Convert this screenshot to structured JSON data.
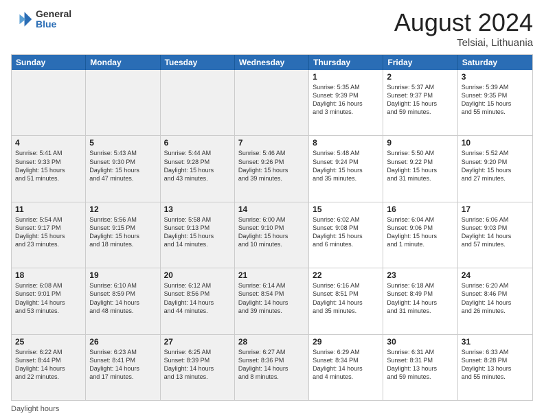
{
  "header": {
    "logo_line1": "General",
    "logo_line2": "Blue",
    "month_title": "August 2024",
    "location": "Telsiai, Lithuania"
  },
  "weekdays": [
    "Sunday",
    "Monday",
    "Tuesday",
    "Wednesday",
    "Thursday",
    "Friday",
    "Saturday"
  ],
  "footer": {
    "daylight_label": "Daylight hours"
  },
  "weeks": [
    [
      {
        "day": "",
        "info": "",
        "shaded": true
      },
      {
        "day": "",
        "info": "",
        "shaded": true
      },
      {
        "day": "",
        "info": "",
        "shaded": true
      },
      {
        "day": "",
        "info": "",
        "shaded": true
      },
      {
        "day": "1",
        "info": "Sunrise: 5:35 AM\nSunset: 9:39 PM\nDaylight: 16 hours\nand 3 minutes.",
        "shaded": false
      },
      {
        "day": "2",
        "info": "Sunrise: 5:37 AM\nSunset: 9:37 PM\nDaylight: 15 hours\nand 59 minutes.",
        "shaded": false
      },
      {
        "day": "3",
        "info": "Sunrise: 5:39 AM\nSunset: 9:35 PM\nDaylight: 15 hours\nand 55 minutes.",
        "shaded": false
      }
    ],
    [
      {
        "day": "4",
        "info": "Sunrise: 5:41 AM\nSunset: 9:33 PM\nDaylight: 15 hours\nand 51 minutes.",
        "shaded": true
      },
      {
        "day": "5",
        "info": "Sunrise: 5:43 AM\nSunset: 9:30 PM\nDaylight: 15 hours\nand 47 minutes.",
        "shaded": true
      },
      {
        "day": "6",
        "info": "Sunrise: 5:44 AM\nSunset: 9:28 PM\nDaylight: 15 hours\nand 43 minutes.",
        "shaded": true
      },
      {
        "day": "7",
        "info": "Sunrise: 5:46 AM\nSunset: 9:26 PM\nDaylight: 15 hours\nand 39 minutes.",
        "shaded": true
      },
      {
        "day": "8",
        "info": "Sunrise: 5:48 AM\nSunset: 9:24 PM\nDaylight: 15 hours\nand 35 minutes.",
        "shaded": false
      },
      {
        "day": "9",
        "info": "Sunrise: 5:50 AM\nSunset: 9:22 PM\nDaylight: 15 hours\nand 31 minutes.",
        "shaded": false
      },
      {
        "day": "10",
        "info": "Sunrise: 5:52 AM\nSunset: 9:20 PM\nDaylight: 15 hours\nand 27 minutes.",
        "shaded": false
      }
    ],
    [
      {
        "day": "11",
        "info": "Sunrise: 5:54 AM\nSunset: 9:17 PM\nDaylight: 15 hours\nand 23 minutes.",
        "shaded": true
      },
      {
        "day": "12",
        "info": "Sunrise: 5:56 AM\nSunset: 9:15 PM\nDaylight: 15 hours\nand 18 minutes.",
        "shaded": true
      },
      {
        "day": "13",
        "info": "Sunrise: 5:58 AM\nSunset: 9:13 PM\nDaylight: 15 hours\nand 14 minutes.",
        "shaded": true
      },
      {
        "day": "14",
        "info": "Sunrise: 6:00 AM\nSunset: 9:10 PM\nDaylight: 15 hours\nand 10 minutes.",
        "shaded": true
      },
      {
        "day": "15",
        "info": "Sunrise: 6:02 AM\nSunset: 9:08 PM\nDaylight: 15 hours\nand 6 minutes.",
        "shaded": false
      },
      {
        "day": "16",
        "info": "Sunrise: 6:04 AM\nSunset: 9:06 PM\nDaylight: 15 hours\nand 1 minute.",
        "shaded": false
      },
      {
        "day": "17",
        "info": "Sunrise: 6:06 AM\nSunset: 9:03 PM\nDaylight: 14 hours\nand 57 minutes.",
        "shaded": false
      }
    ],
    [
      {
        "day": "18",
        "info": "Sunrise: 6:08 AM\nSunset: 9:01 PM\nDaylight: 14 hours\nand 53 minutes.",
        "shaded": true
      },
      {
        "day": "19",
        "info": "Sunrise: 6:10 AM\nSunset: 8:59 PM\nDaylight: 14 hours\nand 48 minutes.",
        "shaded": true
      },
      {
        "day": "20",
        "info": "Sunrise: 6:12 AM\nSunset: 8:56 PM\nDaylight: 14 hours\nand 44 minutes.",
        "shaded": true
      },
      {
        "day": "21",
        "info": "Sunrise: 6:14 AM\nSunset: 8:54 PM\nDaylight: 14 hours\nand 39 minutes.",
        "shaded": true
      },
      {
        "day": "22",
        "info": "Sunrise: 6:16 AM\nSunset: 8:51 PM\nDaylight: 14 hours\nand 35 minutes.",
        "shaded": false
      },
      {
        "day": "23",
        "info": "Sunrise: 6:18 AM\nSunset: 8:49 PM\nDaylight: 14 hours\nand 31 minutes.",
        "shaded": false
      },
      {
        "day": "24",
        "info": "Sunrise: 6:20 AM\nSunset: 8:46 PM\nDaylight: 14 hours\nand 26 minutes.",
        "shaded": false
      }
    ],
    [
      {
        "day": "25",
        "info": "Sunrise: 6:22 AM\nSunset: 8:44 PM\nDaylight: 14 hours\nand 22 minutes.",
        "shaded": true
      },
      {
        "day": "26",
        "info": "Sunrise: 6:23 AM\nSunset: 8:41 PM\nDaylight: 14 hours\nand 17 minutes.",
        "shaded": true
      },
      {
        "day": "27",
        "info": "Sunrise: 6:25 AM\nSunset: 8:39 PM\nDaylight: 14 hours\nand 13 minutes.",
        "shaded": true
      },
      {
        "day": "28",
        "info": "Sunrise: 6:27 AM\nSunset: 8:36 PM\nDaylight: 14 hours\nand 8 minutes.",
        "shaded": true
      },
      {
        "day": "29",
        "info": "Sunrise: 6:29 AM\nSunset: 8:34 PM\nDaylight: 14 hours\nand 4 minutes.",
        "shaded": false
      },
      {
        "day": "30",
        "info": "Sunrise: 6:31 AM\nSunset: 8:31 PM\nDaylight: 13 hours\nand 59 minutes.",
        "shaded": false
      },
      {
        "day": "31",
        "info": "Sunrise: 6:33 AM\nSunset: 8:28 PM\nDaylight: 13 hours\nand 55 minutes.",
        "shaded": false
      }
    ]
  ]
}
